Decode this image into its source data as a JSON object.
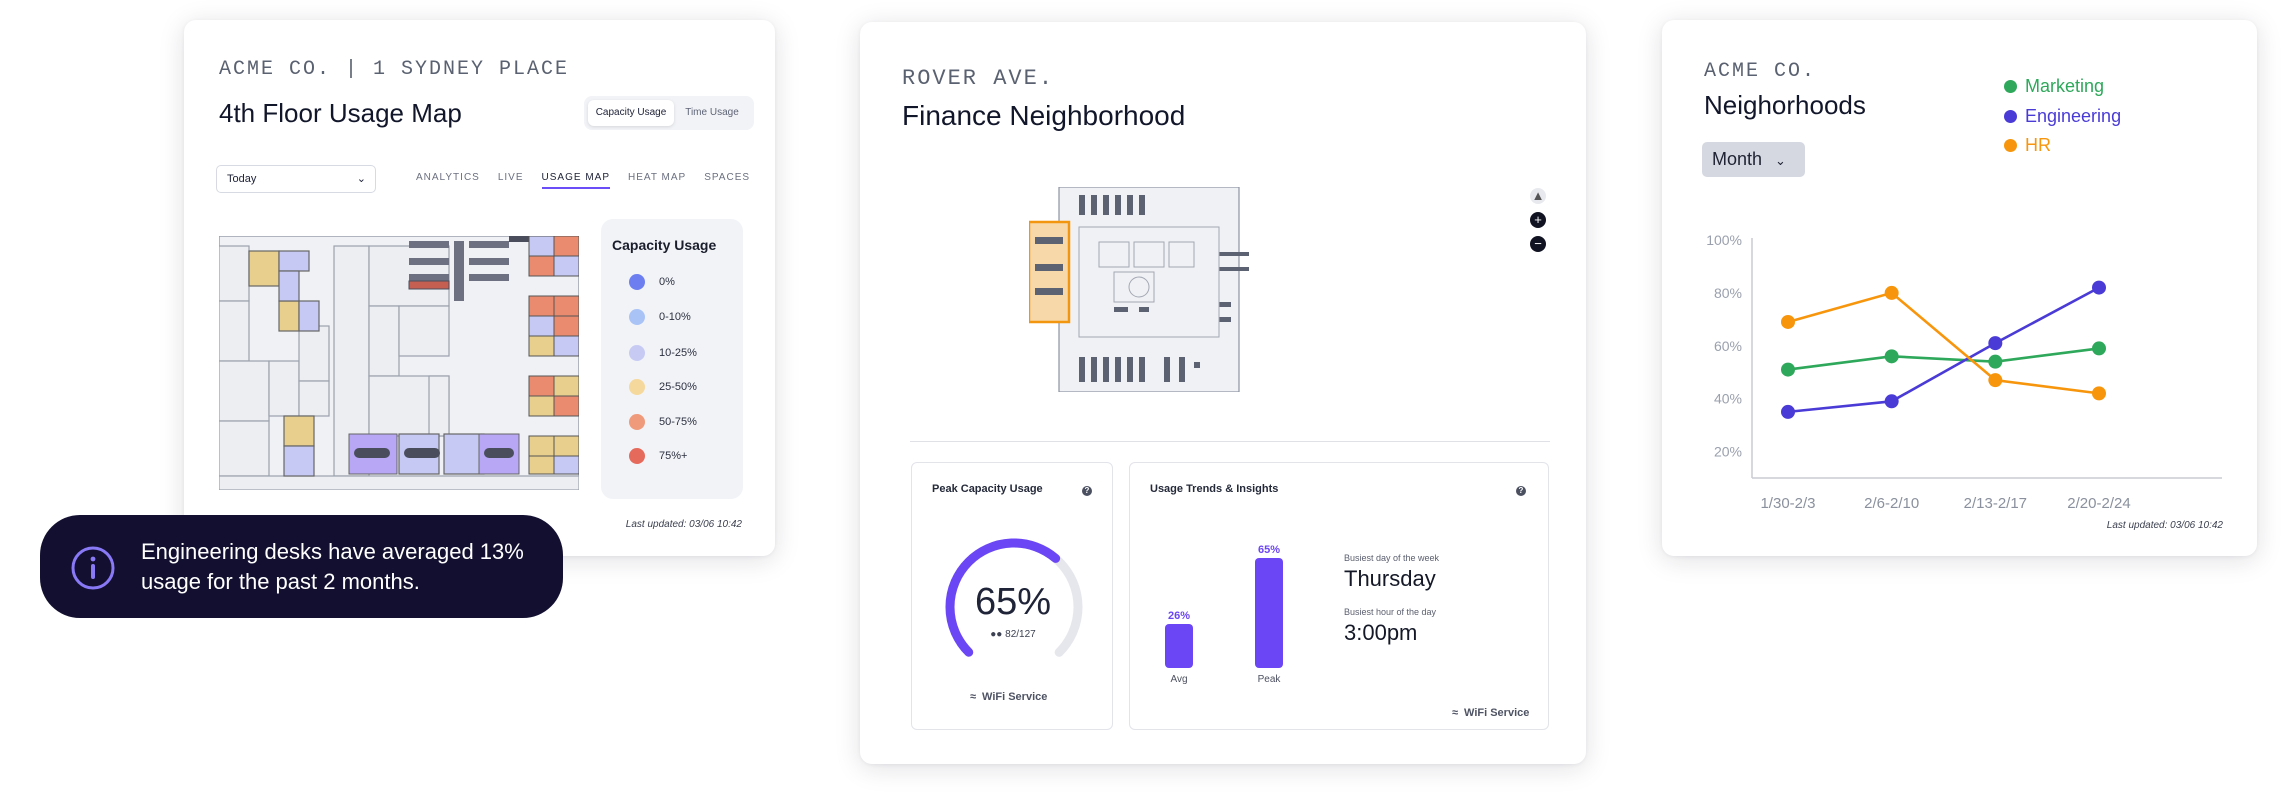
{
  "card_left": {
    "eyebrow": "ACME CO. | 1 SYDNEY PLACE",
    "title": "4th Floor Usage Map",
    "toggle": {
      "active": "Capacity Usage",
      "inactive": "Time Usage"
    },
    "date_select": {
      "value": "Today"
    },
    "tabs": [
      "ANALYTICS",
      "LIVE",
      "USAGE MAP",
      "HEAT MAP",
      "SPACES"
    ],
    "active_tab": "USAGE MAP",
    "legend": {
      "title": "Capacity Usage",
      "items": [
        {
          "label": "0%",
          "color": "#6d7ff0"
        },
        {
          "label": "0-10%",
          "color": "#a9c3f7"
        },
        {
          "label": "10-25%",
          "color": "#c7cbf4"
        },
        {
          "label": "25-50%",
          "color": "#f5d89c"
        },
        {
          "label": "50-75%",
          "color": "#ef9a7b"
        },
        {
          "label": "75%+",
          "color": "#e66a5c"
        }
      ]
    },
    "updated": "Last updated: 03/06 10:42"
  },
  "toast": {
    "icon": "info-icon",
    "message": "Engineering desks have averaged 13% usage for the past 2 months."
  },
  "card_middle": {
    "eyebrow": "ROVER AVE.",
    "title": "Finance Neighborhood",
    "peak": {
      "title": "Peak Capacity Usage",
      "percent": "65%",
      "fraction": "82/127",
      "progress": 0.65,
      "source": "WiFi Service"
    },
    "trends": {
      "title": "Usage Trends & Insights",
      "bars": [
        {
          "label": "Avg",
          "value_label": "26%",
          "value": 26
        },
        {
          "label": "Peak",
          "value_label": "65%",
          "value": 65
        }
      ],
      "busiest_day_label": "Busiest day of the week",
      "busiest_day": "Thursday",
      "busiest_hour_label": "Busiest hour of the day",
      "busiest_hour": "3:00pm",
      "source": "WiFi Service"
    }
  },
  "card_right": {
    "eyebrow": "ACME CO.",
    "title": "Neighorhoods",
    "period": "Month",
    "updated": "Last updated: 03/06 10:42"
  },
  "chart_data": {
    "type": "line",
    "categories": [
      "1/30-2/3",
      "2/6-2/10",
      "2/13-2/17",
      "2/20-2/24"
    ],
    "y_ticks": [
      "100%",
      "80%",
      "60%",
      "40%",
      "20%"
    ],
    "ylim": [
      10,
      100
    ],
    "series": [
      {
        "name": "Marketing",
        "color": "#2ea85a",
        "values": [
          51,
          56,
          54,
          59
        ]
      },
      {
        "name": "Engineering",
        "color": "#4a3bd6",
        "values": [
          35,
          39,
          61,
          82
        ]
      },
      {
        "name": "HR",
        "color": "#f7960d",
        "values": [
          69,
          80,
          47,
          42
        ]
      }
    ]
  }
}
